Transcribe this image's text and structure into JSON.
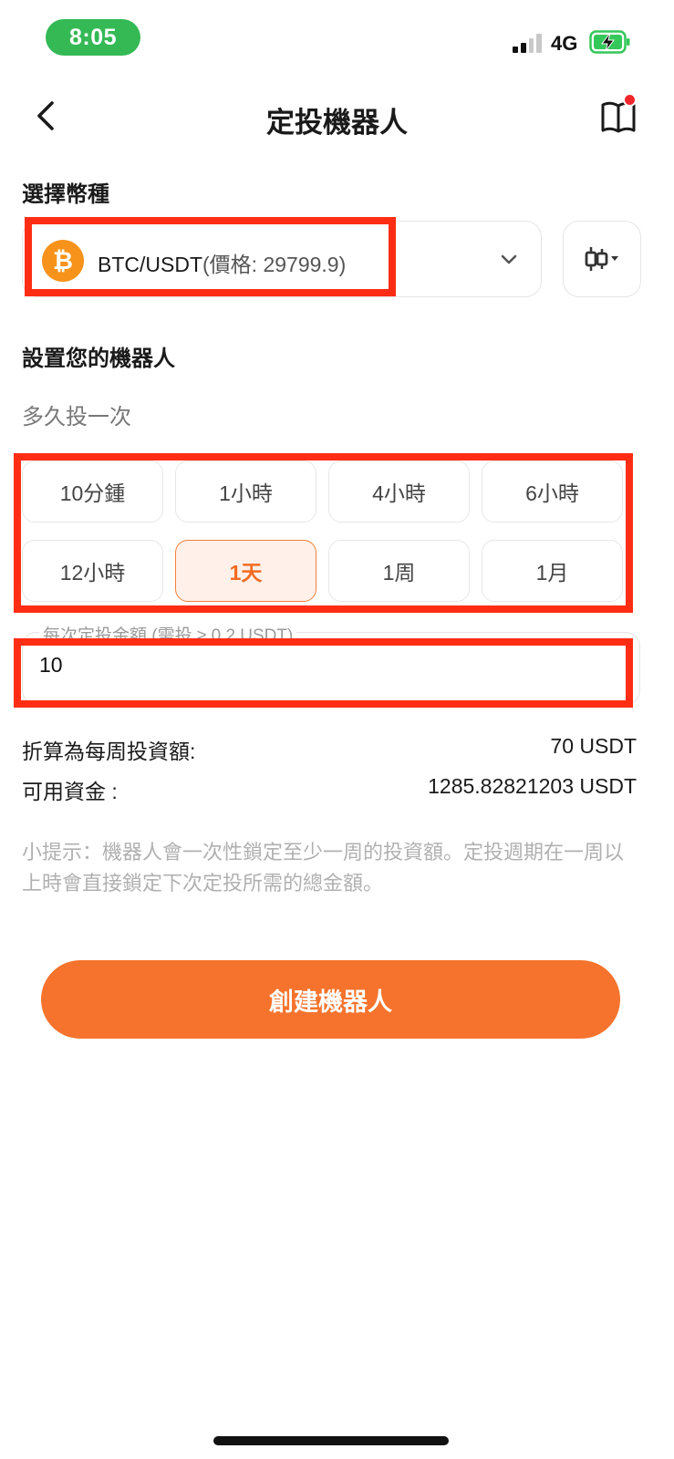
{
  "status_bar": {
    "time": "8:05",
    "network": "4G",
    "time_pill_color": "#34b955",
    "battery_color": "#34c759"
  },
  "header": {
    "title": "定投機器人",
    "back_icon": "chevron-left-icon",
    "guide_icon": "book-icon",
    "notification_dot_color": "#f0262b"
  },
  "pair_section": {
    "title": "選擇幣種",
    "pair": "BTC/USDT",
    "price_text": "(價格: 29799.9)",
    "coin_icon": "bitcoin-icon",
    "dropdown_icon": "chevron-down-icon",
    "chart_icon": "candlestick-icon"
  },
  "robot_section": {
    "title": "設置您的機器人",
    "frequency_label": "多久投一次",
    "frequencies": [
      {
        "label": "10分鍾",
        "selected": false
      },
      {
        "label": "1小時",
        "selected": false
      },
      {
        "label": "4小時",
        "selected": false
      },
      {
        "label": "6小時",
        "selected": false
      },
      {
        "label": "12小時",
        "selected": false
      },
      {
        "label": "1天",
        "selected": true
      },
      {
        "label": "1周",
        "selected": false
      },
      {
        "label": "1月",
        "selected": false
      }
    ],
    "amount_label": "每次定投金額 (需投 ≥ 0.2 USDT)",
    "amount_value": "10"
  },
  "summary": {
    "weekly_label": "折算為每周投資額:",
    "weekly_value": "70 USDT",
    "available_label": "可用資金 :",
    "available_value": "1285.82821203 USDT"
  },
  "tip": "小提示：機器人會一次性鎖定至少一周的投資額。定投週期在一周以上時會直接鎖定下次定投所需的總金額。",
  "create_button": "創建機器人",
  "colors": {
    "accent": "#f5732c",
    "selected_text": "#f36b21",
    "selected_bg": "#fff1ea",
    "annotation_red": "#fe2d14"
  }
}
